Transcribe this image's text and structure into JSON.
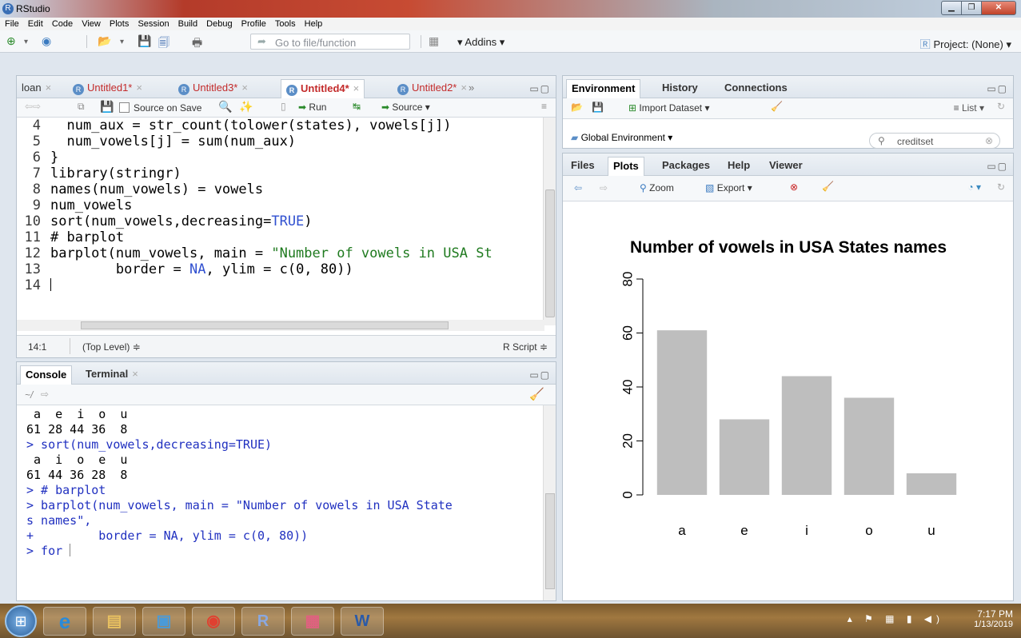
{
  "window": {
    "title": "RStudio"
  },
  "menu": [
    "File",
    "Edit",
    "Code",
    "View",
    "Plots",
    "Session",
    "Build",
    "Debug",
    "Profile",
    "Tools",
    "Help"
  ],
  "toolbar": {
    "goto_placeholder": "Go to file/function",
    "addins": "Addins",
    "project": "Project: (None)"
  },
  "editor": {
    "tabs": [
      {
        "label": "loan",
        "modified": false
      },
      {
        "label": "Untitled1*",
        "modified": true
      },
      {
        "label": "Untitled3*",
        "modified": true
      },
      {
        "label": "Untitled4*",
        "modified": true,
        "active": true
      },
      {
        "label": "Untitled2*",
        "modified": true
      }
    ],
    "source_on_save": "Source on Save",
    "run": "Run",
    "source": "Source",
    "lines": [
      {
        "n": "4",
        "code": "  num_aux = str_count(tolower(states), vowels[j])"
      },
      {
        "n": "5",
        "code": "  num_vowels[j] = sum(num_aux)"
      },
      {
        "n": "6",
        "code": "}"
      },
      {
        "n": "7",
        "code": "library(stringr)"
      },
      {
        "n": "8",
        "code": "names(num_vowels) = vowels"
      },
      {
        "n": "9",
        "code": "num_vowels"
      },
      {
        "n": "10",
        "code_a": "sort(num_vowels,decreasing=",
        "code_b": "TRUE",
        "code_c": ")"
      },
      {
        "n": "11",
        "code": "# barplot"
      },
      {
        "n": "12",
        "code_a": "barplot(num_vowels, main = ",
        "code_b": "\"Number of vowels in USA St"
      },
      {
        "n": "13",
        "code_a": "        border = ",
        "code_b": "NA",
        "code_c": ", ylim = c(0, 80))"
      },
      {
        "n": "14",
        "code": ""
      }
    ],
    "status_pos": "14:1",
    "status_scope": "(Top Level) ≑",
    "status_type": "R Script ≑"
  },
  "console": {
    "tabs": [
      "Console",
      "Terminal"
    ],
    "path": "~/",
    "lines": [
      {
        "text": " a  e  i  o  u",
        "cmd": false
      },
      {
        "text": "61 28 44 36  8",
        "cmd": false
      },
      {
        "text": "> sort(num_vowels,decreasing=TRUE)",
        "cmd": true
      },
      {
        "text": " a  i  o  e  u",
        "cmd": false
      },
      {
        "text": "61 44 36 28  8",
        "cmd": false
      },
      {
        "text": "> # barplot",
        "cmd": true
      },
      {
        "text": "> barplot(num_vowels, main = \"Number of vowels in USA State",
        "cmd": true
      },
      {
        "text": "s names\",",
        "cmd": true
      },
      {
        "text": "+         border = NA, ylim = c(0, 80))",
        "cmd": true
      },
      {
        "text": "> for ",
        "cmd": true
      }
    ]
  },
  "environment": {
    "tabs": [
      "Environment",
      "History",
      "Connections"
    ],
    "import": "Import Dataset",
    "list": "List",
    "scope": "Global Environment",
    "search": "creditset"
  },
  "plots": {
    "tabs": [
      "Files",
      "Plots",
      "Packages",
      "Help",
      "Viewer"
    ],
    "zoom": "Zoom",
    "export": "Export"
  },
  "chart_data": {
    "type": "bar",
    "title": "Number of vowels in USA States names",
    "categories": [
      "a",
      "e",
      "i",
      "o",
      "u"
    ],
    "values": [
      61,
      28,
      44,
      36,
      8
    ],
    "ylim": [
      0,
      80
    ],
    "yticks": [
      0,
      20,
      40,
      60,
      80
    ],
    "xlabel": "",
    "ylabel": "",
    "bar_color": "#bebebe"
  },
  "taskbar": {
    "time": "7:17 PM",
    "date": "1/13/2019"
  }
}
